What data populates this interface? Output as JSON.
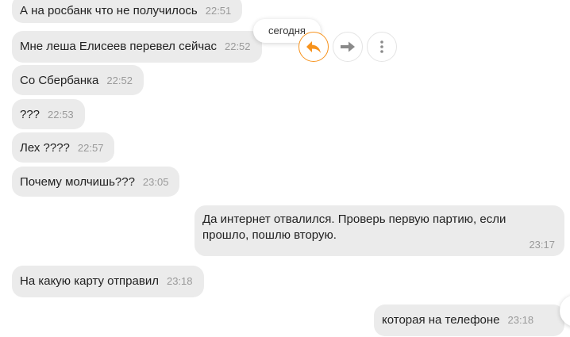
{
  "date_label": "сегодня",
  "colors": {
    "accent": "#f7931e",
    "bubble": "#ebebeb",
    "time": "#9a9a9a"
  },
  "actions": {
    "reply_icon": "reply-icon",
    "forward_icon": "forward-icon",
    "more_icon": "more-vertical-icon"
  },
  "messages": [
    {
      "text": "А на росбанк что не получилось",
      "time": "22:51",
      "direction": "in"
    },
    {
      "text": "Мне леша Елисеев перевел сейчас",
      "time": "22:52",
      "direction": "in"
    },
    {
      "text": "Со Сбербанка",
      "time": "22:52",
      "direction": "in"
    },
    {
      "text": "???",
      "time": "22:53",
      "direction": "in"
    },
    {
      "text": "Лех ????",
      "time": "22:57",
      "direction": "in"
    },
    {
      "text": "Почему молчишь???",
      "time": "23:05",
      "direction": "in"
    },
    {
      "text": "Да интернет отвалился. Проверь первую партию, если прошло, пошлю вторую.",
      "time": "23:17",
      "direction": "out"
    },
    {
      "text": "На какую карту отправил",
      "time": "23:18",
      "direction": "in"
    },
    {
      "text": "которая на телефоне",
      "time": "23:18",
      "direction": "out"
    }
  ]
}
